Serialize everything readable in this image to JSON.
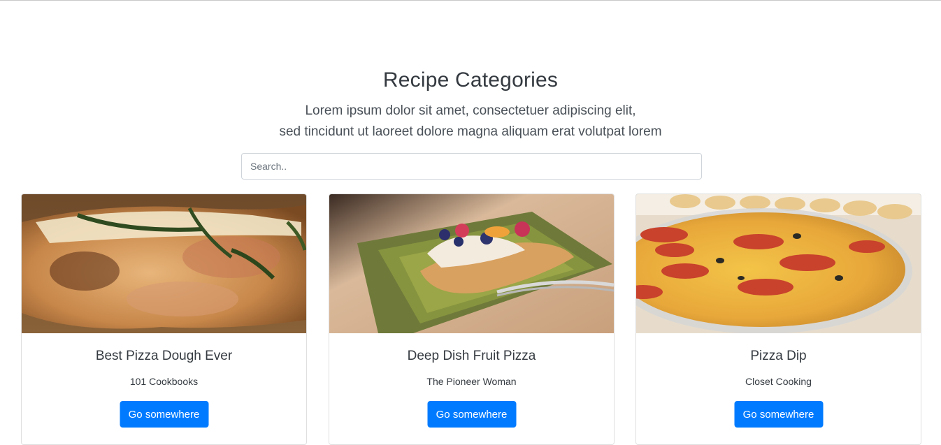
{
  "header": {
    "title": "Recipe Categories",
    "lead_line_1": "Lorem ipsum dolor sit amet, consectetuer adipiscing elit,",
    "lead_line_2": "sed tincidunt ut laoreet dolore magna aliquam erat volutpat lorem"
  },
  "search": {
    "placeholder": "Search..",
    "value": ""
  },
  "cards": [
    {
      "title": "Best Pizza Dough Ever",
      "source": "101 Cookbooks",
      "button_label": "Go somewhere",
      "image": "pizza-crust-photo"
    },
    {
      "title": "Deep Dish Fruit Pizza",
      "source": "The Pioneer Woman",
      "button_label": "Go somewhere",
      "image": "fruit-pizza-photo"
    },
    {
      "title": "Pizza Dip",
      "source": "Closet Cooking",
      "button_label": "Go somewhere",
      "image": "pizza-dip-photo"
    }
  ],
  "colors": {
    "primary_button": "#007bff",
    "border": "#dfdfdf"
  }
}
